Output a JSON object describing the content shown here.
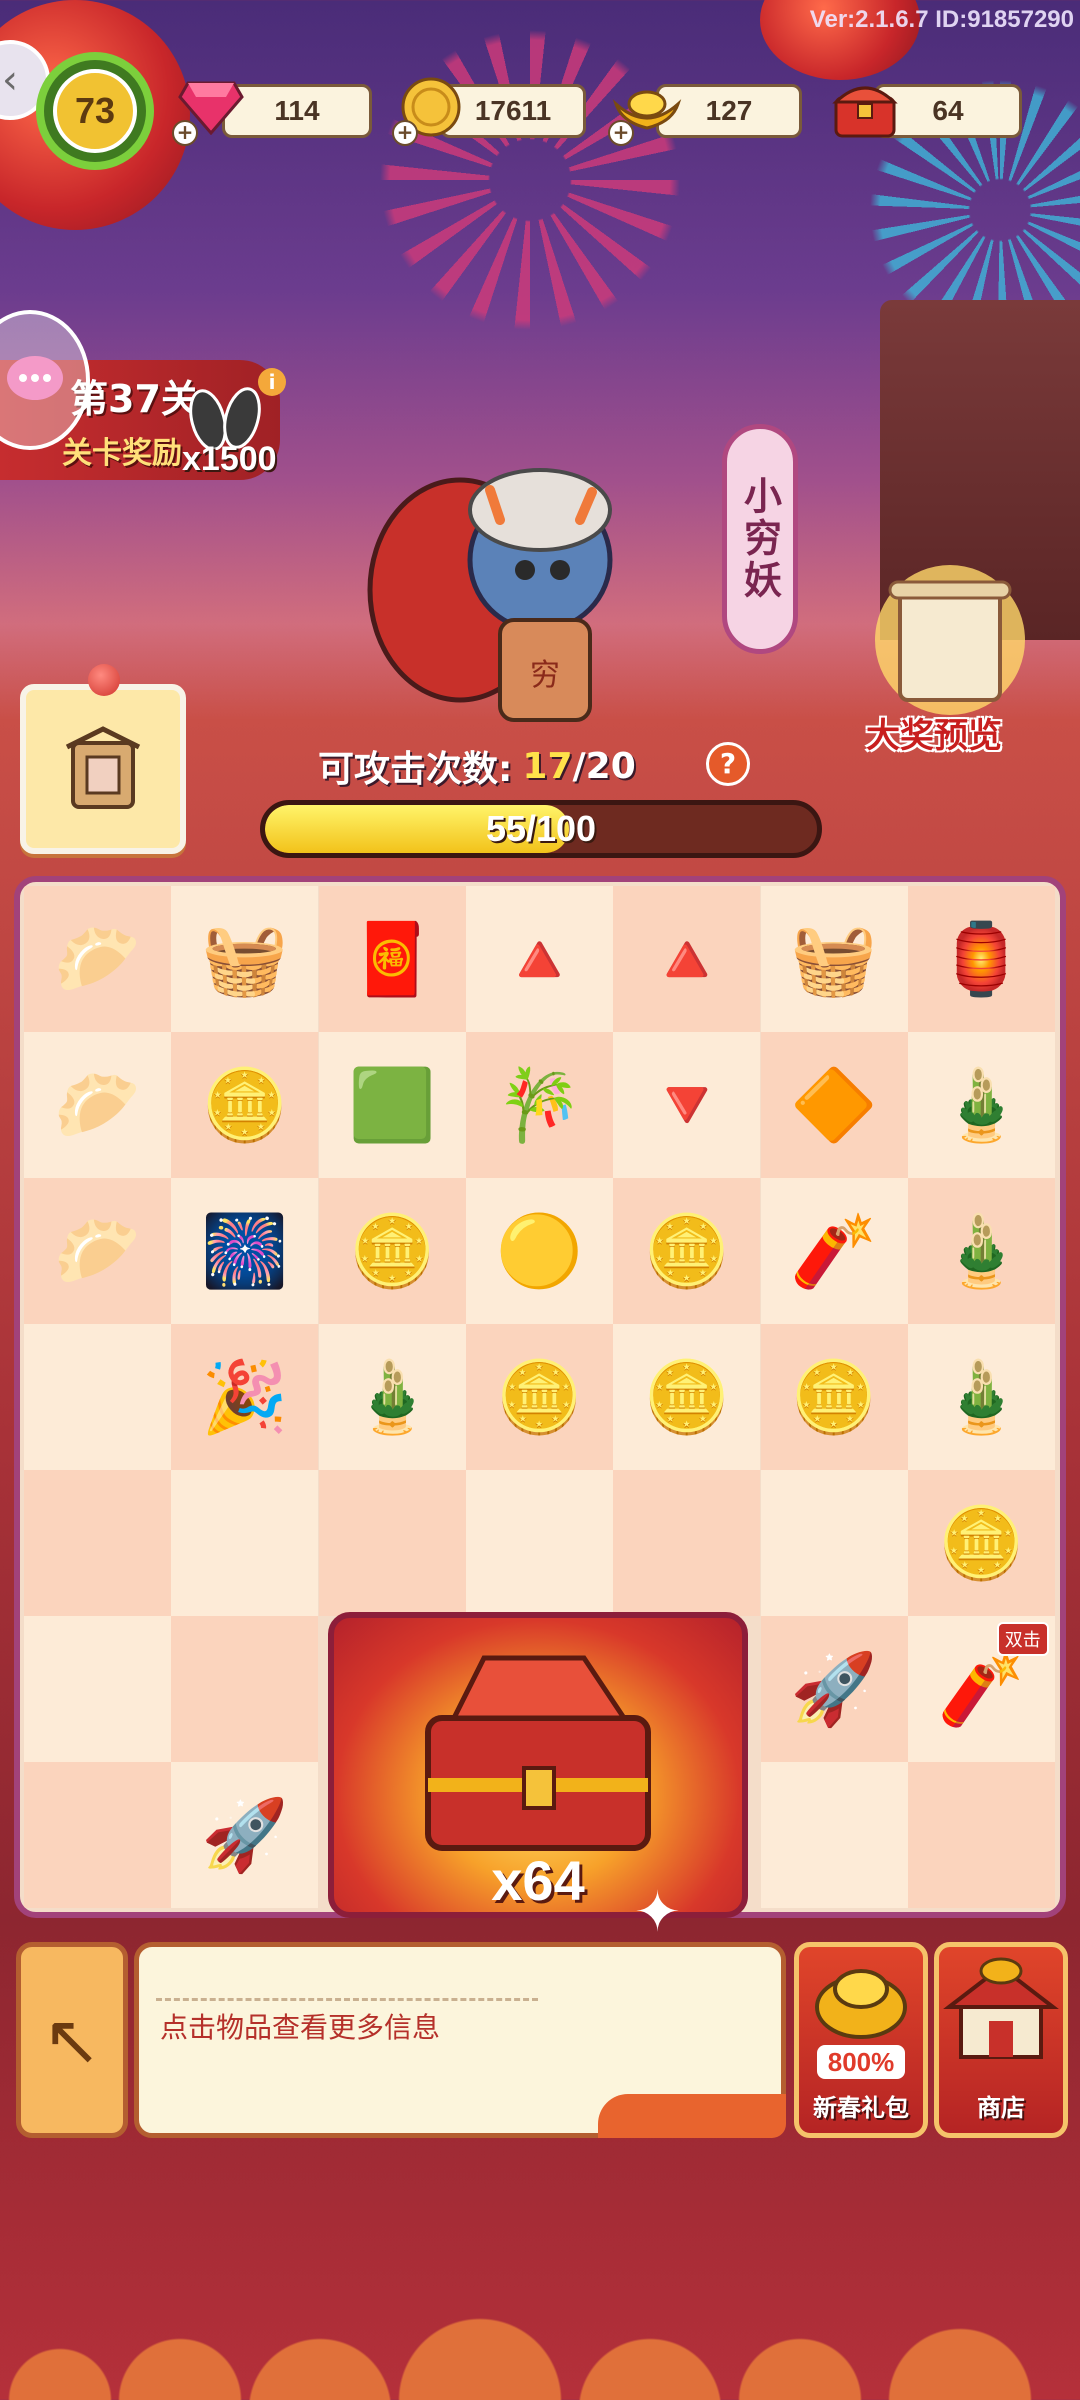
{
  "version": "Ver:2.1.6.7 ID:91857290",
  "player": {
    "level": "73"
  },
  "resources": [
    {
      "name": "gem",
      "value": "114",
      "icon": "gem-icon"
    },
    {
      "name": "coin",
      "value": "17611",
      "icon": "coin-icon"
    },
    {
      "name": "gold-ingot",
      "value": "127",
      "icon": "gold-ingot-icon"
    },
    {
      "name": "chest",
      "value": "64",
      "icon": "treasure-chest-icon"
    }
  ],
  "stage": {
    "title": "第37关",
    "subtitle": "关卡奖励",
    "reward_count": "x1500",
    "info": "i"
  },
  "monster": {
    "name": "小穷妖",
    "badge_text": "穷"
  },
  "prize_preview": {
    "label": "大奖预览"
  },
  "attack": {
    "label": "可攻击次数:",
    "current": "17",
    "max": "/20",
    "help": "?"
  },
  "hp": {
    "current": 55,
    "max": 100,
    "text": "55/100"
  },
  "board": {
    "rows": [
      [
        "dumplings",
        "rice-sack",
        "red-envelope-fold",
        "red-paper-fold",
        "red-paper-triangle",
        "rice-sack",
        "lantern"
      ],
      [
        "dumpling",
        "gold-ingots",
        "bamboo-lantern-frame",
        "bamboo-frame",
        "red-paper-small",
        "red-diamond-paper",
        "bamboo"
      ],
      [
        "dumpling-plate",
        "firework-rockets",
        "gold-ingot",
        "coin",
        "gold-ingot",
        "firecracker",
        "bamboo"
      ],
      [
        "",
        "party-hat",
        "bamboo",
        "gold-ingot",
        "gold-ingot",
        "gold-ingot",
        "bamboo"
      ],
      [
        "",
        "",
        "",
        "",
        "",
        "",
        "gold-ingot"
      ],
      [
        "",
        "",
        "",
        "",
        "",
        "firework-rocket",
        "firecracker-string"
      ],
      [
        "",
        "firework-rocket",
        "",
        "",
        "",
        "",
        ""
      ]
    ],
    "double_badge": "双击"
  },
  "big_chest": {
    "count": "x64"
  },
  "bottom": {
    "hint": "点击物品查看更多信息",
    "gift_label": "新春礼包",
    "gift_percent": "800%",
    "shop_label": "商店"
  },
  "colors": {
    "accent": "#a2427a",
    "hp_fill": "#f2c21a",
    "panel": "#fcf5dc"
  }
}
